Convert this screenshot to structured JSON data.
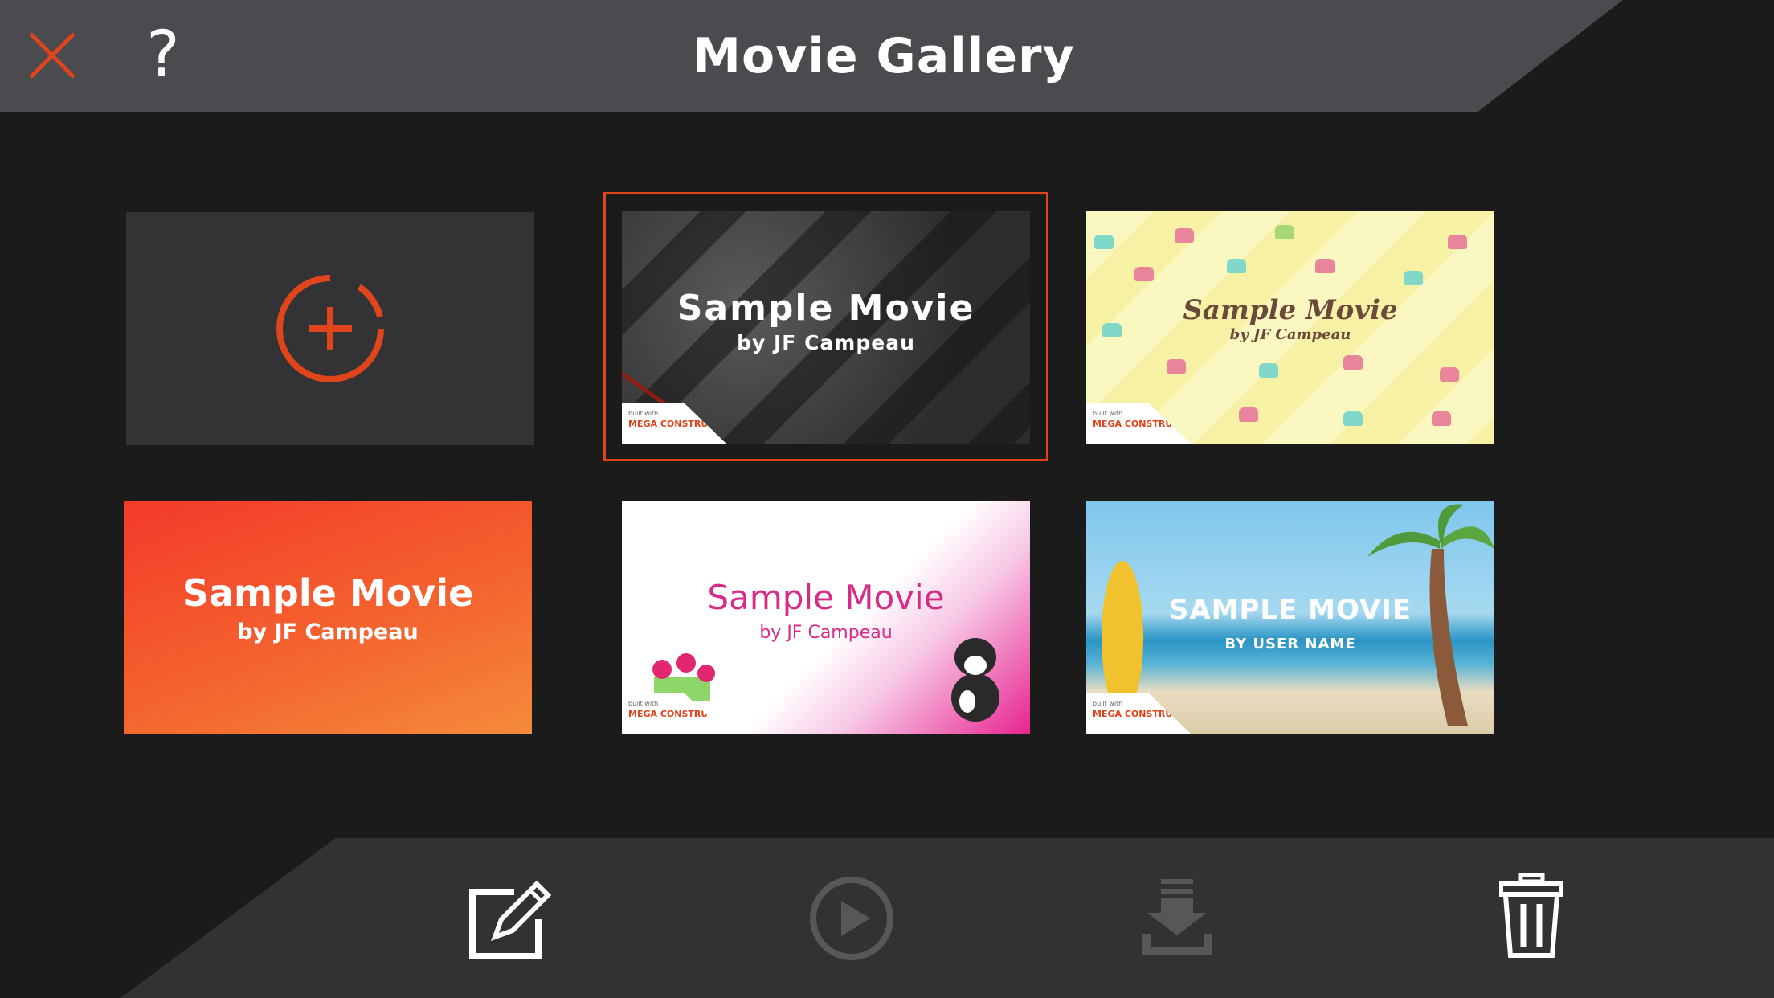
{
  "header": {
    "title": "Movie Gallery",
    "help_label": "?",
    "close_icon": "close-icon",
    "accent_color": "#e0441b"
  },
  "gallery": {
    "new_movie_icon": "add-circle-icon",
    "items": [
      {
        "title": "Sample Movie",
        "subtitle": "by JF Campeau",
        "theme": "dark",
        "selected": true,
        "badge_small": "built with",
        "badge_brand": "MEGA CONSTRUX"
      },
      {
        "title": "Sample Movie",
        "subtitle": "by JF Campeau",
        "theme": "yellow-cupcakes",
        "selected": false,
        "badge_small": "built with",
        "badge_brand": "MEGA CONSTRUX"
      },
      {
        "title": "Sample Movie",
        "subtitle": "by JF Campeau",
        "theme": "red-orange",
        "selected": false
      },
      {
        "title": "Sample Movie",
        "subtitle": "by JF Campeau",
        "theme": "pink",
        "selected": false,
        "badge_small": "built with",
        "badge_brand": "MEGA CONSTRUX"
      },
      {
        "title": "SAMPLE MOVIE",
        "subtitle": "BY USER NAME",
        "theme": "beach",
        "selected": false,
        "badge_small": "built with",
        "badge_brand": "MEGA CONSTRUX"
      }
    ]
  },
  "toolbar": {
    "edit_icon": "edit-icon",
    "play_icon": "play-icon",
    "download_icon": "download-icon",
    "delete_icon": "trash-icon",
    "play_enabled": false,
    "download_enabled": false
  }
}
